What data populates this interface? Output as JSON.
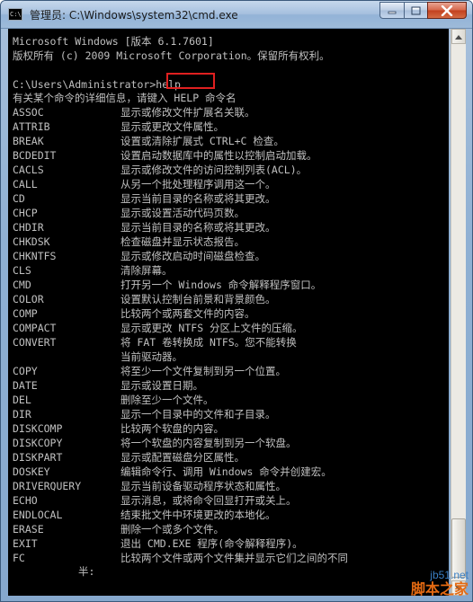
{
  "window": {
    "title": "管理员: C:\\Windows\\system32\\cmd.exe",
    "icon_text": "C:\\"
  },
  "console": {
    "header": [
      "Microsoft Windows [版本 6.1.7601]",
      "版权所有 (c) 2009 Microsoft Corporation。保留所有权利。"
    ],
    "prompt": "C:\\Users\\Administrator",
    "prompt_suffix": ">",
    "command": "help",
    "help_intro": "有关某个命令的详细信息，请键入 HELP 命令名",
    "commands": [
      {
        "name": "ASSOC",
        "desc": "显示或修改文件扩展名关联。"
      },
      {
        "name": "ATTRIB",
        "desc": "显示或更改文件属性。"
      },
      {
        "name": "BREAK",
        "desc": "设置或清除扩展式 CTRL+C 检查。"
      },
      {
        "name": "BCDEDIT",
        "desc": "设置启动数据库中的属性以控制启动加载。"
      },
      {
        "name": "CACLS",
        "desc": "显示或修改文件的访问控制列表(ACL)。"
      },
      {
        "name": "CALL",
        "desc": "从另一个批处理程序调用这一个。"
      },
      {
        "name": "CD",
        "desc": "显示当前目录的名称或将其更改。"
      },
      {
        "name": "CHCP",
        "desc": "显示或设置活动代码页数。"
      },
      {
        "name": "CHDIR",
        "desc": "显示当前目录的名称或将其更改。"
      },
      {
        "name": "CHKDSK",
        "desc": "检查磁盘并显示状态报告。"
      },
      {
        "name": "CHKNTFS",
        "desc": "显示或修改启动时间磁盘检查。"
      },
      {
        "name": "CLS",
        "desc": "清除屏幕。"
      },
      {
        "name": "CMD",
        "desc": "打开另一个 Windows 命令解释程序窗口。"
      },
      {
        "name": "COLOR",
        "desc": "设置默认控制台前景和背景颜色。"
      },
      {
        "name": "COMP",
        "desc": "比较两个或两套文件的内容。"
      },
      {
        "name": "COMPACT",
        "desc": "显示或更改 NTFS 分区上文件的压缩。"
      },
      {
        "name": "CONVERT",
        "desc": "将 FAT 卷转换成 NTFS。您不能转换"
      },
      {
        "name": "",
        "desc": "当前驱动器。"
      },
      {
        "name": "COPY",
        "desc": "将至少一个文件复制到另一个位置。"
      },
      {
        "name": "DATE",
        "desc": "显示或设置日期。"
      },
      {
        "name": "DEL",
        "desc": "删除至少一个文件。"
      },
      {
        "name": "DIR",
        "desc": "显示一个目录中的文件和子目录。"
      },
      {
        "name": "DISKCOMP",
        "desc": "比较两个软盘的内容。"
      },
      {
        "name": "DISKCOPY",
        "desc": "将一个软盘的内容复制到另一个软盘。"
      },
      {
        "name": "DISKPART",
        "desc": "显示或配置磁盘分区属性。"
      },
      {
        "name": "DOSKEY",
        "desc": "编辑命令行、调用 Windows 命令并创建宏。"
      },
      {
        "name": "DRIVERQUERY",
        "desc": "显示当前设备驱动程序状态和属性。"
      },
      {
        "name": "ECHO",
        "desc": "显示消息，或将命令回显打开或关上。"
      },
      {
        "name": "ENDLOCAL",
        "desc": "结束批文件中环境更改的本地化。"
      },
      {
        "name": "ERASE",
        "desc": "删除一个或多个文件。"
      },
      {
        "name": "EXIT",
        "desc": "退出 CMD.EXE 程序(命令解释程序)。"
      },
      {
        "name": "FC",
        "desc": "比较两个文件或两个文件集并显示它们之间的不同"
      }
    ],
    "ime_indicator": "半:"
  },
  "watermark": {
    "url": "jb51.net",
    "brand": "脚本之家"
  },
  "colors": {
    "console_bg": "#000000",
    "console_text": "#c0c0c0",
    "highlight": "#e02020"
  },
  "icons": {
    "minimize": "minimize-icon",
    "maximize": "maximize-icon",
    "close": "close-icon",
    "scroll_up": "arrow-up-icon",
    "scroll_down": "arrow-down-icon"
  }
}
